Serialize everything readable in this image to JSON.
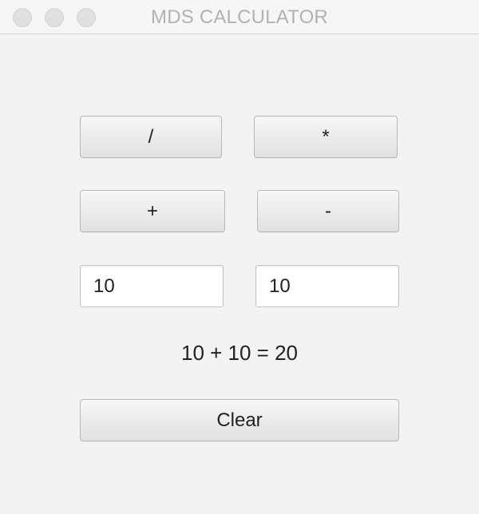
{
  "window": {
    "title": "MDS CALCULATOR"
  },
  "operators": {
    "divide": "/",
    "multiply": "*",
    "add": "+",
    "subtract": "-"
  },
  "inputs": {
    "first": {
      "value": "10"
    },
    "second": {
      "value": "10"
    }
  },
  "result": {
    "text": "10 + 10 = 20"
  },
  "actions": {
    "clear_label": "Clear"
  },
  "colors": {
    "window_background": "#f3f3f3",
    "title_text": "#b2b2b2",
    "button_border": "#b8b8b8",
    "text": "#222222"
  },
  "icons": {
    "close": "close-icon",
    "minimize": "minimize-icon",
    "zoom": "zoom-icon"
  }
}
